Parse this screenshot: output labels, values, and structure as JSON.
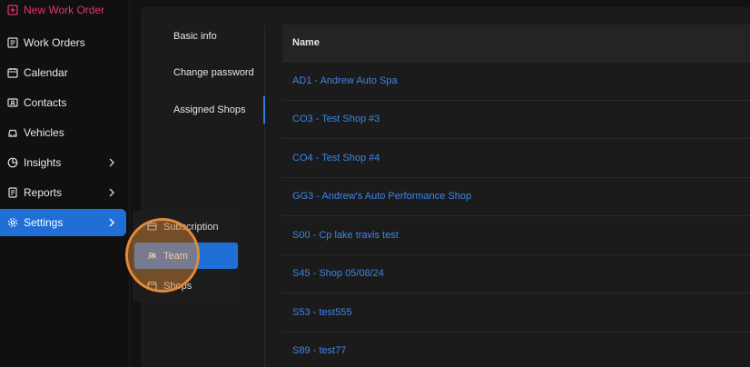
{
  "sidebar": {
    "new_work_order": "New Work Order",
    "items": [
      {
        "label": "Work Orders",
        "icon": "work-orders-icon"
      },
      {
        "label": "Calendar",
        "icon": "calendar-icon"
      },
      {
        "label": "Contacts",
        "icon": "contacts-icon"
      },
      {
        "label": "Vehicles",
        "icon": "car-icon"
      },
      {
        "label": "Insights",
        "icon": "pie-chart-icon",
        "has_submenu": true
      },
      {
        "label": "Reports",
        "icon": "report-icon",
        "has_submenu": true
      },
      {
        "label": "Settings",
        "icon": "gear-icon",
        "has_submenu": true,
        "active": true
      }
    ]
  },
  "flyout": {
    "items": [
      {
        "label": "Subscription",
        "icon": "subscription-icon"
      },
      {
        "label": "Team",
        "icon": "team-icon",
        "active": true
      },
      {
        "label": "Shops",
        "icon": "shops-icon"
      }
    ]
  },
  "settings_tabs": [
    {
      "label": "Basic info"
    },
    {
      "label": "Change password"
    },
    {
      "label": "Assigned Shops",
      "active": true
    }
  ],
  "table": {
    "header": "Name",
    "rows": [
      "AD1 - Andrew Auto Spa",
      "CO3 - Test Shop #3",
      "CO4 - Test Shop #4",
      "GG3 - Andrew's Auto Performance Shop",
      "S00 - Cp lake travis test",
      "S45 - Shop 05/08/24",
      "S53 - test555",
      "S89 - test77"
    ]
  },
  "colors": {
    "accent": "#1f6fd6",
    "link": "#3d84e8",
    "new_work_order": "#e5336f",
    "highlight": "#e08a3a"
  }
}
